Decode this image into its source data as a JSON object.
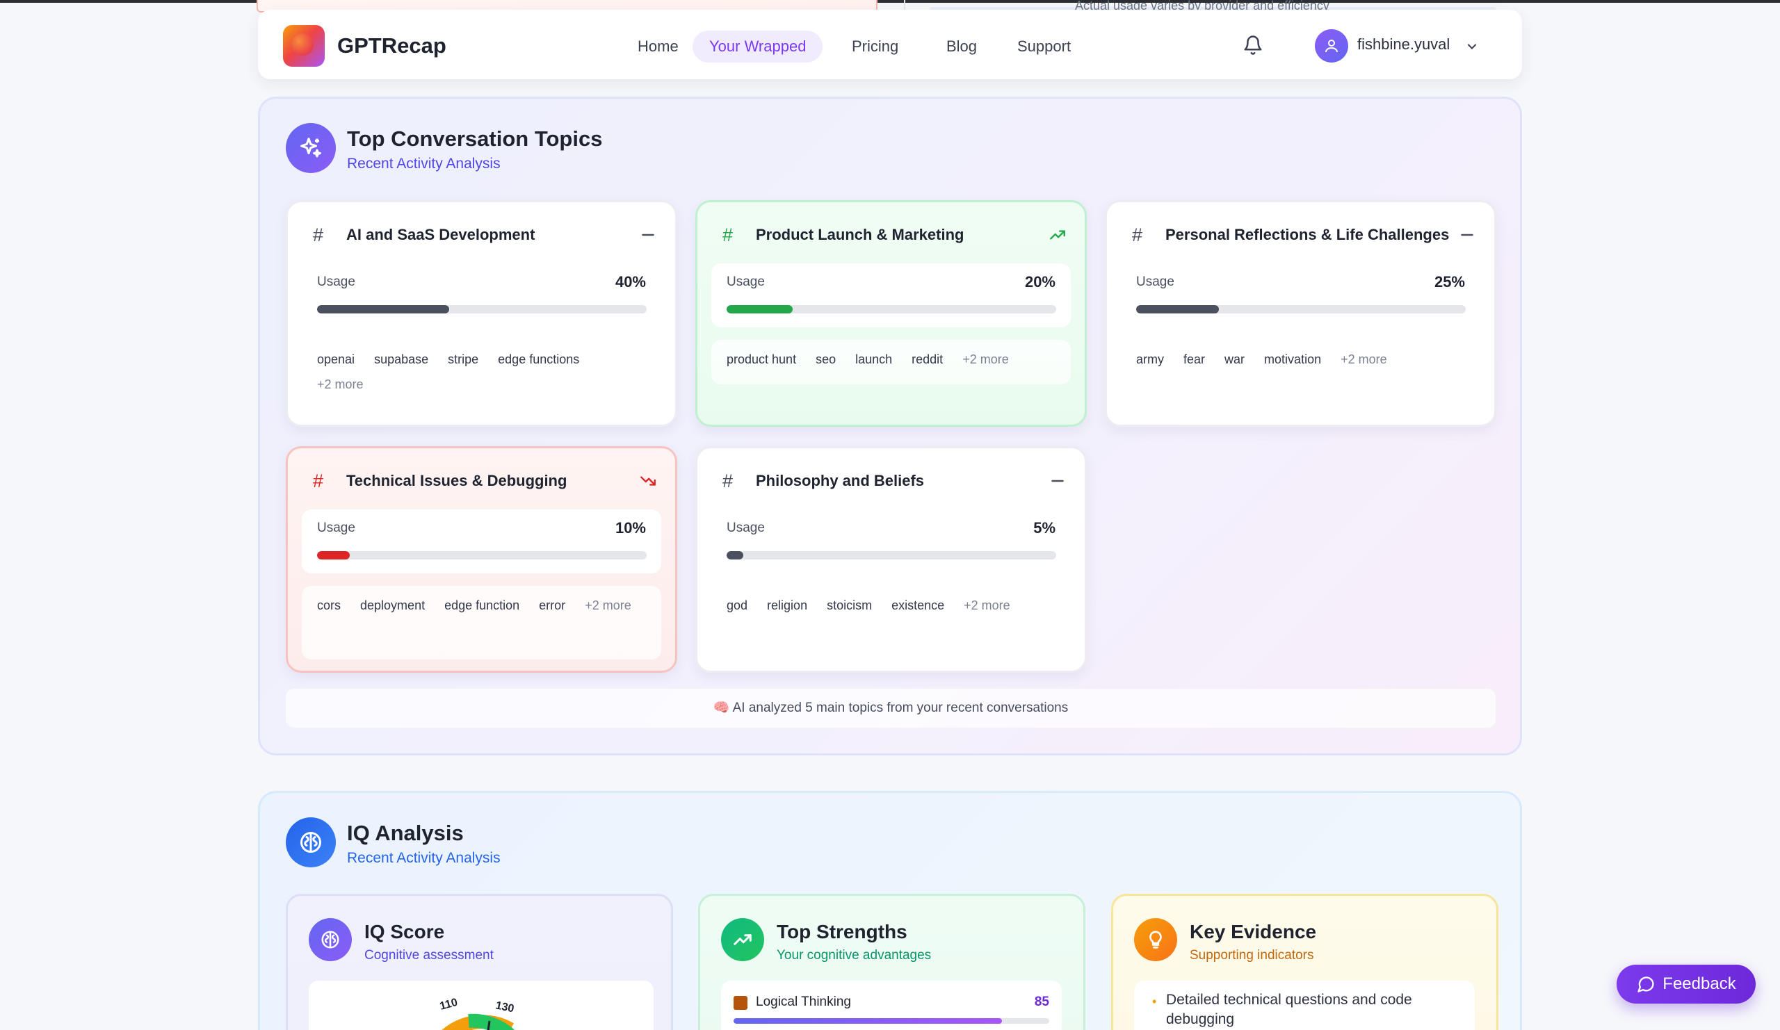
{
  "top_peek": {
    "text": "Actual usage varies by provider and efficiency"
  },
  "navbar": {
    "brand": "GPTRecap",
    "links": [
      "Home",
      "Your Wrapped",
      "Pricing",
      "Blog",
      "Support"
    ],
    "active_link": "Your Wrapped",
    "username": "fishbine.yuval"
  },
  "topics": {
    "title": "Top Conversation Topics",
    "subtitle": "Recent Activity Analysis",
    "usage_label": "Usage",
    "cards": [
      {
        "title": "AI and SaaS Development",
        "usage": "40%",
        "usage_fraction": 0.4,
        "trend": "flat",
        "tags": [
          "openai",
          "supabase",
          "stripe",
          "edge functions"
        ],
        "more": "+2 more",
        "accent": "#4a5060"
      },
      {
        "title": "Product Launch & Marketing",
        "usage": "20%",
        "usage_fraction": 0.2,
        "trend": "up",
        "tags": [
          "product hunt",
          "seo",
          "launch",
          "reddit"
        ],
        "more": "+2 more",
        "accent": "#22a84a"
      },
      {
        "title": "Personal Reflections & Life Challenges",
        "usage": "25%",
        "usage_fraction": 0.25,
        "trend": "flat",
        "tags": [
          "army",
          "fear",
          "war",
          "motivation"
        ],
        "more": "+2 more",
        "accent": "#4a5060"
      },
      {
        "title": "Technical Issues & Debugging",
        "usage": "10%",
        "usage_fraction": 0.1,
        "trend": "down",
        "tags": [
          "cors",
          "deployment",
          "edge function",
          "error"
        ],
        "more": "+2 more",
        "accent": "#dc2626"
      },
      {
        "title": "Philosophy and Beliefs",
        "usage": "5%",
        "usage_fraction": 0.05,
        "trend": "flat",
        "tags": [
          "god",
          "religion",
          "stoicism",
          "existence"
        ],
        "more": "+2 more",
        "accent": "#4a5060"
      }
    ],
    "footer": "🧠 AI analyzed 5 main topics from your recent conversations"
  },
  "iq": {
    "title": "IQ Analysis",
    "subtitle": "Recent Activity Analysis",
    "score_card": {
      "title": "IQ Score",
      "subtitle": "Cognitive assessment",
      "gauge_labels": [
        "110",
        "130"
      ]
    },
    "strengths_card": {
      "title": "Top Strengths",
      "subtitle": "Your cognitive advantages",
      "first_item": {
        "label": "Logical Thinking",
        "score": "85",
        "fraction": 0.85
      }
    },
    "evidence_card": {
      "title": "Key Evidence",
      "subtitle": "Supporting indicators",
      "first_item": "Detailed technical questions and code debugging"
    }
  },
  "feedback_button": "Feedback",
  "colors": {
    "brand_purple": "#7c3aed",
    "indigo": "#4f46e5",
    "blue": "#2563eb",
    "green": "#22a84a",
    "red": "#dc2626",
    "amber": "#f59e0b"
  }
}
